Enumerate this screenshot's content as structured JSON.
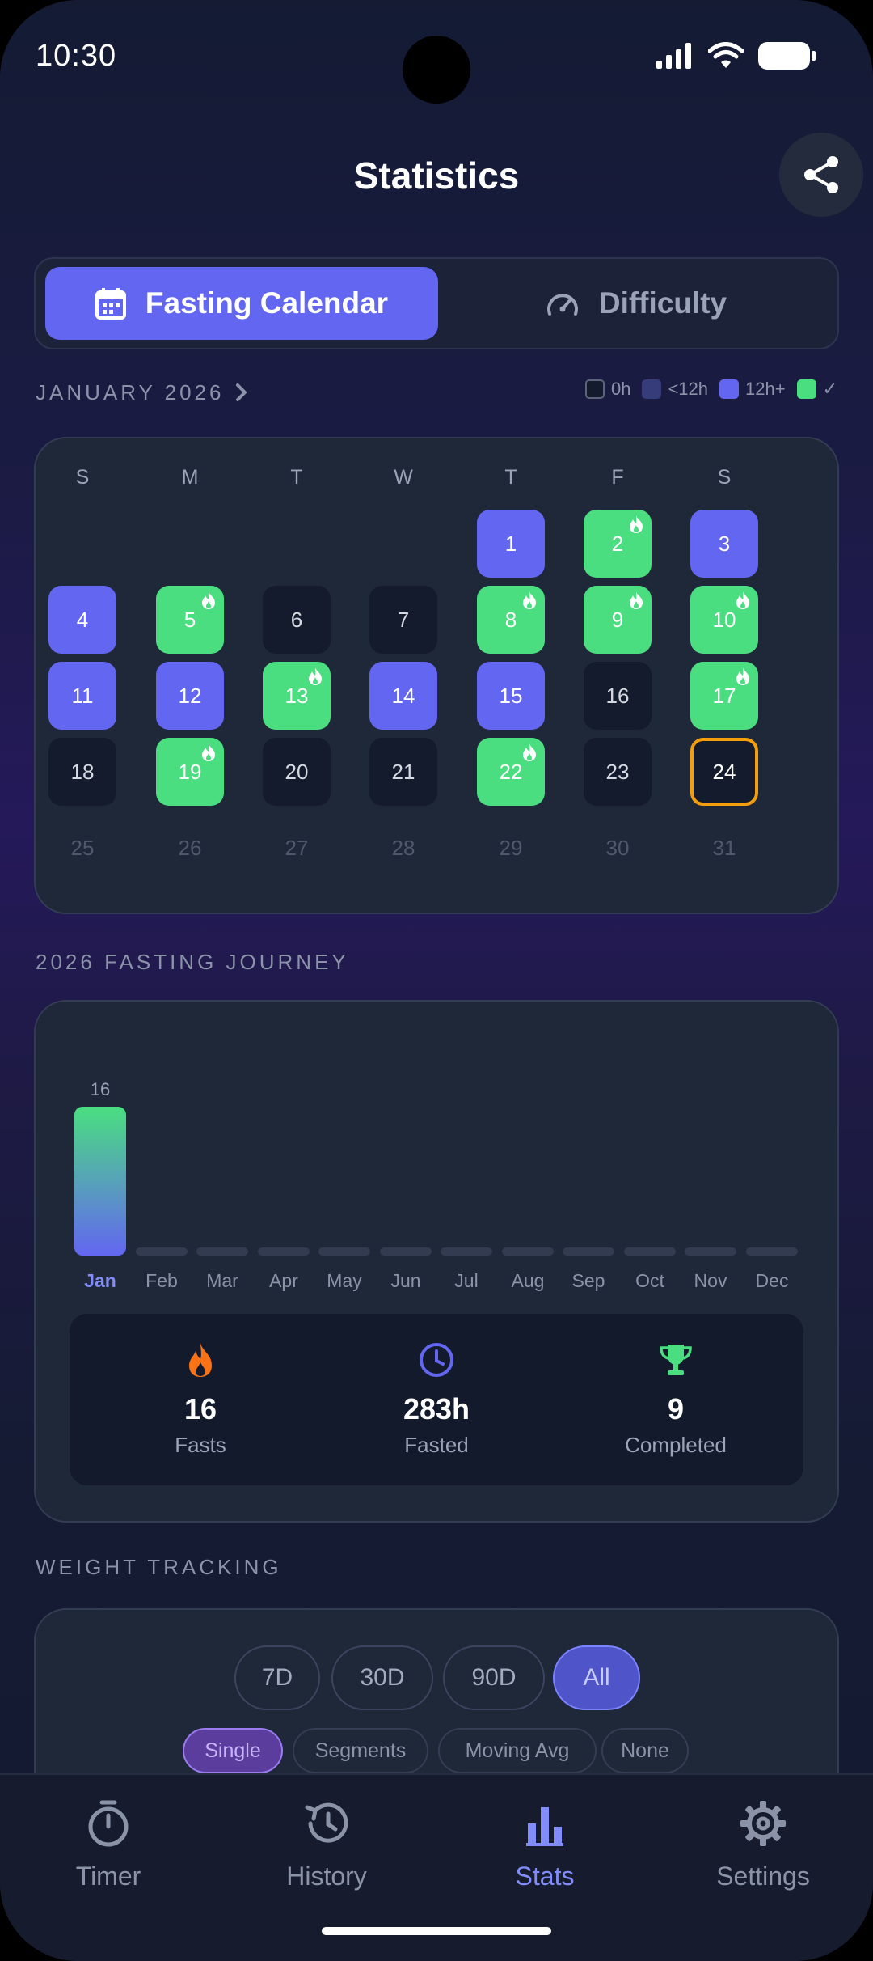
{
  "status_bar": {
    "time": "10:30"
  },
  "header": {
    "title": "Statistics"
  },
  "tabs": [
    {
      "label": "Fasting Calendar",
      "icon": "calendar-icon",
      "active": true
    },
    {
      "label": "Difficulty",
      "icon": "gauge-icon",
      "active": false
    }
  ],
  "calendar": {
    "month_label": "JANUARY 2026",
    "legend": [
      {
        "label": "0h",
        "color": "#141b2c"
      },
      {
        "label": "<12h",
        "color": "#363c7a"
      },
      {
        "label": "12h+",
        "color": "#6366f1"
      },
      {
        "label": "✓",
        "color": "#4ade80"
      }
    ],
    "weekdays": [
      "S",
      "M",
      "T",
      "W",
      "T",
      "F",
      "S"
    ],
    "days": [
      {
        "d": "1",
        "s": "purple"
      },
      {
        "d": "2",
        "s": "green",
        "f": true
      },
      {
        "d": "3",
        "s": "purple"
      },
      {
        "d": "4",
        "s": "purple"
      },
      {
        "d": "5",
        "s": "green",
        "f": true
      },
      {
        "d": "6",
        "s": "none"
      },
      {
        "d": "7",
        "s": "none"
      },
      {
        "d": "8",
        "s": "green",
        "f": true
      },
      {
        "d": "9",
        "s": "green",
        "f": true
      },
      {
        "d": "10",
        "s": "green",
        "f": true
      },
      {
        "d": "11",
        "s": "purple"
      },
      {
        "d": "12",
        "s": "purple"
      },
      {
        "d": "13",
        "s": "green",
        "f": true
      },
      {
        "d": "14",
        "s": "purple"
      },
      {
        "d": "15",
        "s": "purple"
      },
      {
        "d": "16",
        "s": "none"
      },
      {
        "d": "17",
        "s": "green",
        "f": true
      },
      {
        "d": "18",
        "s": "none"
      },
      {
        "d": "19",
        "s": "green",
        "f": true
      },
      {
        "d": "20",
        "s": "none"
      },
      {
        "d": "21",
        "s": "none"
      },
      {
        "d": "22",
        "s": "green",
        "f": true
      },
      {
        "d": "23",
        "s": "none"
      },
      {
        "d": "24",
        "s": "today"
      },
      {
        "d": "25",
        "s": "future"
      },
      {
        "d": "26",
        "s": "future"
      },
      {
        "d": "27",
        "s": "future"
      },
      {
        "d": "28",
        "s": "future"
      },
      {
        "d": "29",
        "s": "future"
      },
      {
        "d": "30",
        "s": "future"
      },
      {
        "d": "31",
        "s": "future"
      }
    ]
  },
  "journey": {
    "section_title": "2026 FASTING JOURNEY",
    "chart_data": {
      "type": "bar",
      "categories": [
        "Jan",
        "Feb",
        "Mar",
        "Apr",
        "May",
        "Jun",
        "Jul",
        "Aug",
        "Sep",
        "Oct",
        "Nov",
        "Dec"
      ],
      "values": [
        16,
        0,
        0,
        0,
        0,
        0,
        0,
        0,
        0,
        0,
        0,
        0
      ],
      "value_labels": [
        "16",
        "",
        "",
        "",
        "",
        "",
        "",
        "",
        "",
        "",
        "",
        ""
      ],
      "highlight": "Jan",
      "title": "",
      "xlabel": "",
      "ylabel": "",
      "ylim": [
        0,
        16
      ]
    },
    "stats": [
      {
        "value": "16",
        "label": "Fasts",
        "icon": "flame-icon",
        "color": "#f97316"
      },
      {
        "value": "283h",
        "label": "Fasted",
        "icon": "clock-icon",
        "color": "#6366f1"
      },
      {
        "value": "9",
        "label": "Completed",
        "icon": "trophy-icon",
        "color": "#4ade80"
      }
    ]
  },
  "weight": {
    "section_title": "WEIGHT TRACKING",
    "ranges": [
      "7D",
      "30D",
      "90D",
      "All"
    ],
    "active_range": "All",
    "modes": [
      "Single",
      "Segments",
      "Moving Avg",
      "None"
    ],
    "active_mode": "Single"
  },
  "nav": [
    {
      "label": "Timer",
      "icon": "timer-icon",
      "active": false
    },
    {
      "label": "History",
      "icon": "history-icon",
      "active": false
    },
    {
      "label": "Stats",
      "icon": "bar-chart-icon",
      "active": true
    },
    {
      "label": "Settings",
      "icon": "gear-icon",
      "active": false
    }
  ],
  "colors": {
    "accent": "#6366f1",
    "success": "#4ade80",
    "today": "#f59e0b",
    "flame": "#f97316"
  }
}
